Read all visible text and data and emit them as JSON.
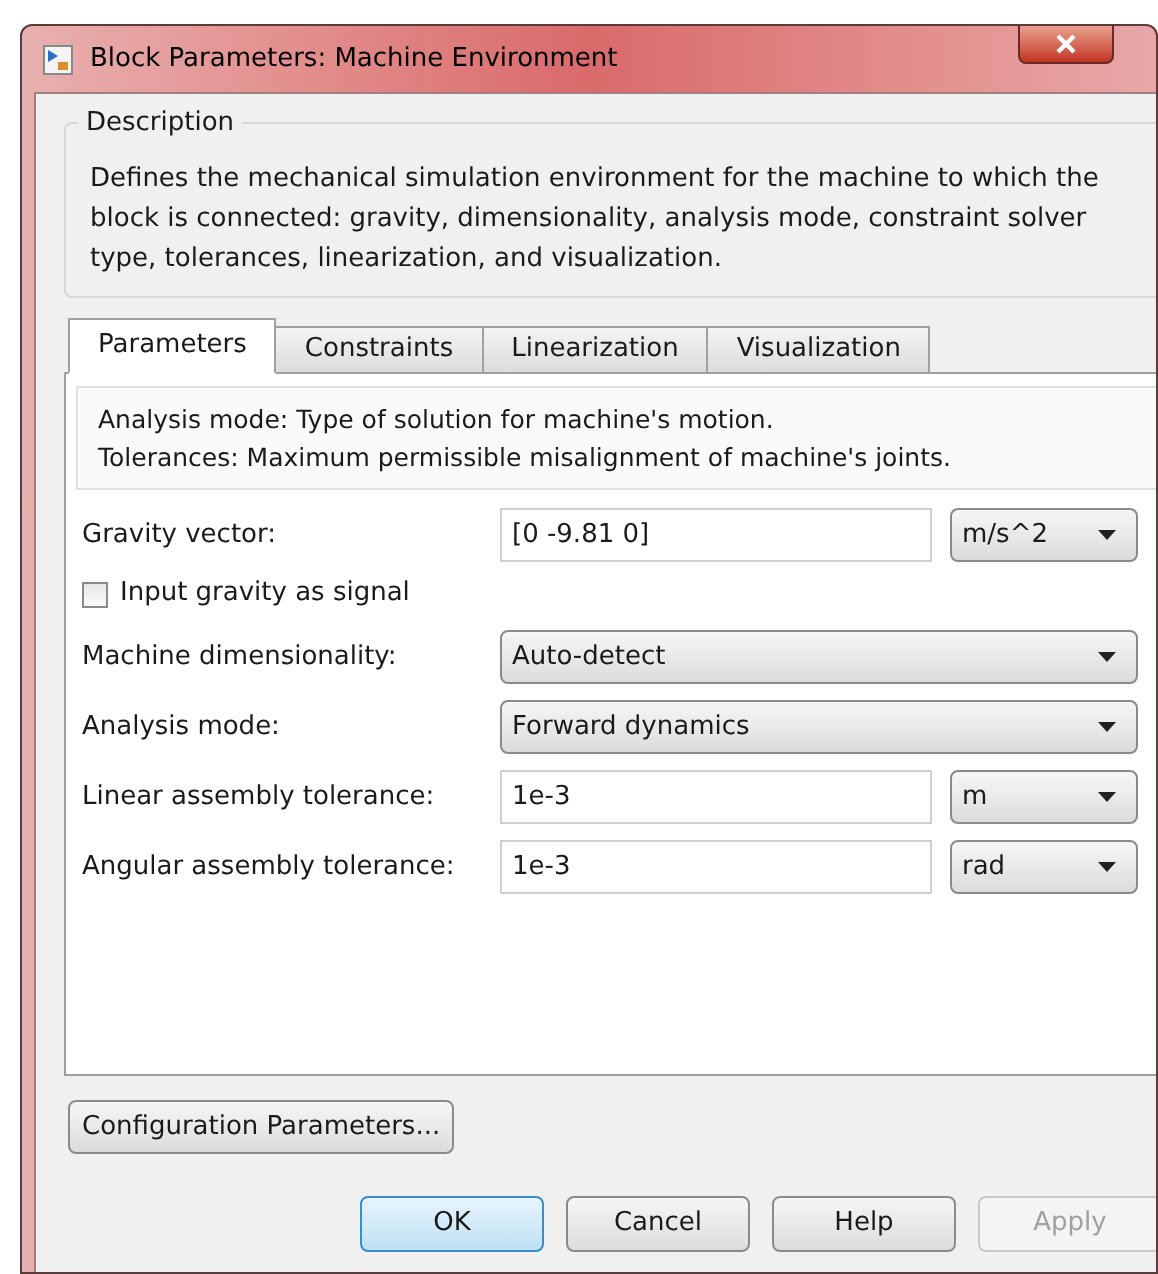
{
  "window": {
    "title": "Block Parameters: Machine Environment"
  },
  "description": {
    "heading": "Description",
    "text": "Defines the mechanical simulation environment for the machine to which the block is connected: gravity, dimensionality, analysis mode, constraint solver type, tolerances, linearization, and visualization."
  },
  "tabs": [
    {
      "label": "Parameters",
      "selected": true
    },
    {
      "label": "Constraints",
      "selected": false
    },
    {
      "label": "Linearization",
      "selected": false
    },
    {
      "label": "Visualization",
      "selected": false
    }
  ],
  "help_lines": [
    "Analysis mode: Type of solution for machine's motion.",
    "Tolerances: Maximum permissible misalignment of machine's joints."
  ],
  "parameters": [
    {
      "kind": "field_unit",
      "label": "Gravity vector:",
      "value": "[0 -9.81 0]",
      "unit": "m/s^2"
    },
    {
      "kind": "checkbox",
      "label": "Input gravity as signal",
      "checked": false
    },
    {
      "kind": "dropdown",
      "label": "Machine dimensionality:",
      "value": "Auto-detect"
    },
    {
      "kind": "dropdown",
      "label": "Analysis mode:",
      "value": "Forward dynamics"
    },
    {
      "kind": "field_unit",
      "label": "Linear assembly tolerance:",
      "value": "1e-3",
      "unit": "m"
    },
    {
      "kind": "field_unit",
      "label": "Angular assembly tolerance:",
      "value": "1e-3",
      "unit": "rad"
    }
  ],
  "config_button": "Configuration Parameters...",
  "buttons": [
    {
      "label": "OK",
      "default": true,
      "disabled": false
    },
    {
      "label": "Cancel",
      "default": false,
      "disabled": false
    },
    {
      "label": "Help",
      "default": false,
      "disabled": false
    },
    {
      "label": "Apply",
      "default": false,
      "disabled": true
    }
  ]
}
